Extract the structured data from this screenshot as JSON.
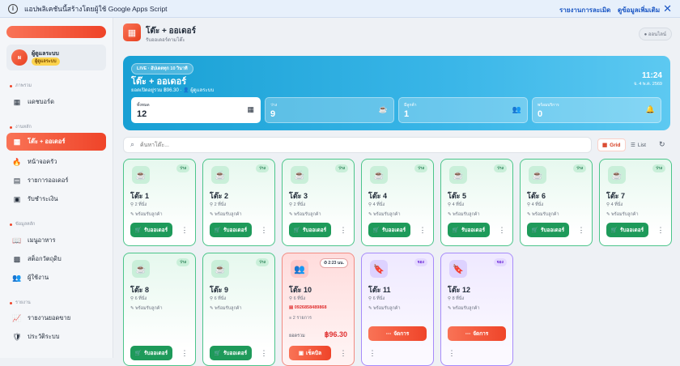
{
  "banner": {
    "message": "แอปพลิเคชันนี้สร้างโดยผู้ใช้ Google Apps Script",
    "report_link": "รายงานการละเมิด",
    "more_link": "ดูข้อมูลเพิ่มเติม"
  },
  "sidebar": {
    "user": {
      "initial": "ผ",
      "name": "ผู้ดูแลระบบ",
      "role": "ผู้ดูแลระบบ"
    },
    "sections": [
      "ภาพรวม",
      "งานหลัก",
      "ข้อมูลหลัก",
      "รายงาน"
    ],
    "items": [
      {
        "label": "แดชบอร์ด",
        "icon": "dashboard-icon"
      },
      {
        "label": "โต๊ะ + ออเดอร์",
        "icon": "grid-icon",
        "active": true
      },
      {
        "label": "หน้าจอครัว",
        "icon": "flame-icon"
      },
      {
        "label": "รายการออเดอร์",
        "icon": "list-icon"
      },
      {
        "label": "รับชำระเงิน",
        "icon": "cash-icon"
      },
      {
        "label": "เมนูอาหาร",
        "icon": "book-icon"
      },
      {
        "label": "สต็อกวัตถุดิบ",
        "icon": "box-icon"
      },
      {
        "label": "ผู้ใช้งาน",
        "icon": "users-icon"
      },
      {
        "label": "รายงานยอดขาย",
        "icon": "chart-icon"
      },
      {
        "label": "ประวัติระบบ",
        "icon": "shield-icon"
      }
    ]
  },
  "header": {
    "title": "โต๊ะ + ออเดอร์",
    "subtitle": "รับออเดอร์ตามโต๊ะ",
    "online": "ออนไลน์"
  },
  "hero": {
    "live": "LIVE · อัปเดตทุก 10 วินาที",
    "title": "โต๊ะ + ออเดอร์",
    "sub": "ยอดเปิดอยู่รวม ฿96.30 · 👤 ผู้ดูแลระบบ",
    "time": "11:24",
    "date": "จ. 4 พ.ค. 2569",
    "stats": [
      {
        "label": "ทั้งหมด",
        "value": "12",
        "icon": "grid-icon"
      },
      {
        "label": "ว่าง",
        "value": "9",
        "icon": "cup-icon"
      },
      {
        "label": "มีลูกค้า",
        "value": "1",
        "icon": "users-icon"
      },
      {
        "label": "พร้อมบริการ",
        "value": "0",
        "icon": "bell-icon"
      }
    ]
  },
  "search": {
    "placeholder": "ค้นหาโต๊ะ..."
  },
  "view": {
    "grid": "Grid",
    "list": "List"
  },
  "cards": [
    {
      "name": "โต๊ะ 1",
      "seats": "2 ที่นั่ง",
      "badge": "ว่าง",
      "type": "free",
      "status": "พร้อมรับลูกค้า",
      "button": "รับออเดอร์"
    },
    {
      "name": "โต๊ะ 2",
      "seats": "2 ที่นั่ง",
      "badge": "ว่าง",
      "type": "free",
      "status": "พร้อมรับลูกค้า",
      "button": "รับออเดอร์"
    },
    {
      "name": "โต๊ะ 3",
      "seats": "2 ที่นั่ง",
      "badge": "ว่าง",
      "type": "free",
      "status": "พร้อมรับลูกค้า",
      "button": "รับออเดอร์"
    },
    {
      "name": "โต๊ะ 4",
      "seats": "4 ที่นั่ง",
      "badge": "ว่าง",
      "type": "free",
      "status": "พร้อมรับลูกค้า",
      "button": "รับออเดอร์"
    },
    {
      "name": "โต๊ะ 5",
      "seats": "4 ที่นั่ง",
      "badge": "ว่าง",
      "type": "free",
      "status": "พร้อมรับลูกค้า",
      "button": "รับออเดอร์"
    },
    {
      "name": "โต๊ะ 6",
      "seats": "4 ที่นั่ง",
      "badge": "ว่าง",
      "type": "free",
      "status": "พร้อมรับลูกค้า",
      "button": "รับออเดอร์"
    },
    {
      "name": "โต๊ะ 7",
      "seats": "4 ที่นั่ง",
      "badge": "ว่าง",
      "type": "free",
      "status": "พร้อมรับลูกค้า",
      "button": "รับออเดอร์"
    },
    {
      "name": "โต๊ะ 8",
      "seats": "6 ที่นั่ง",
      "badge": "ว่าง",
      "type": "free",
      "status": "พร้อมรับลูกค้า",
      "button": "รับออเดอร์"
    },
    {
      "name": "โต๊ะ 9",
      "seats": "6 ที่นั่ง",
      "badge": "ว่าง",
      "type": "free",
      "status": "พร้อมรับลูกค้า",
      "button": "รับออเดอร์"
    },
    {
      "name": "โต๊ะ 10",
      "seats": "6 ที่นั่ง",
      "badge": "⏱ 2:23 นน.",
      "type": "busy",
      "phone": "0926858489868",
      "items": "2 รายการ",
      "total_label": "ยอดรวม",
      "total": "฿96.30",
      "button": "เช็คบิล"
    },
    {
      "name": "โต๊ะ 11",
      "seats": "6 ที่นั่ง",
      "badge": "จอง",
      "type": "res",
      "status": "พร้อมรับลูกค้า",
      "button": "จัดการ"
    },
    {
      "name": "โต๊ะ 12",
      "seats": "8 ที่นั่ง",
      "badge": "จอง",
      "type": "res",
      "status": "พร้อมรับลูกค้า",
      "button": "จัดการ"
    }
  ]
}
